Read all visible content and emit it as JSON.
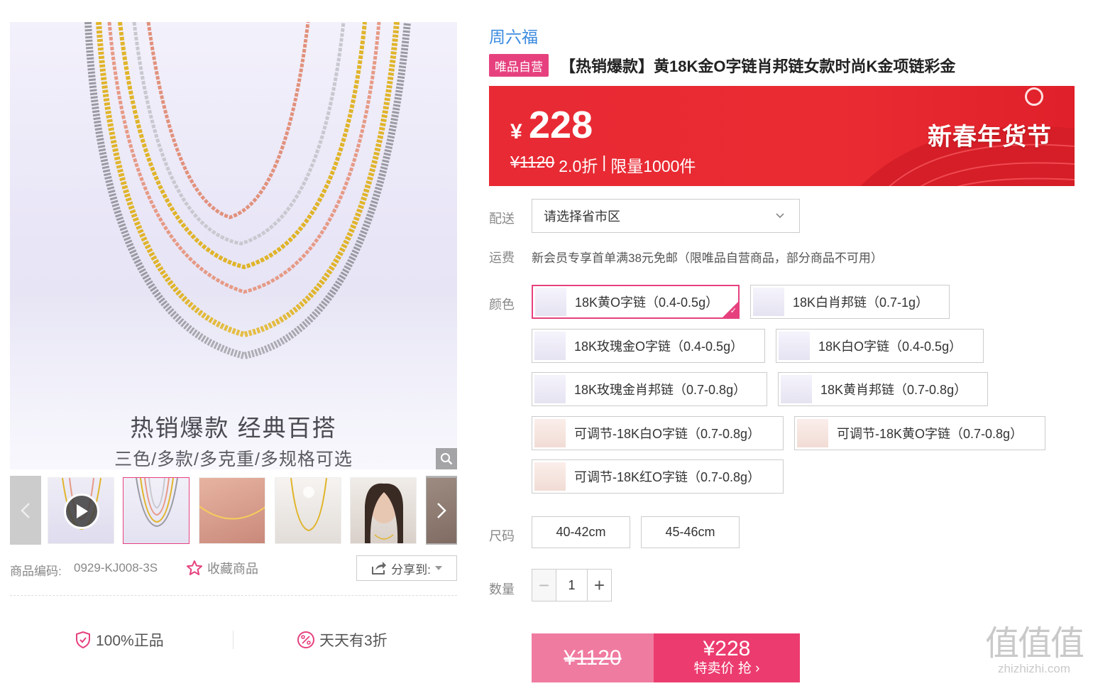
{
  "gallery": {
    "slogan_main": "热销爆款 经典百搭",
    "slogan_sub": "三色/多款/多克重/多规格可选",
    "sku_label": "商品编码:",
    "sku_value": "0929-KJ008-3S",
    "favorite_label": "收藏商品",
    "share_label": "分享到:",
    "assurances": [
      "100%正品",
      "天天有3折"
    ]
  },
  "product": {
    "brand": "周六福",
    "self_badge": "唯品自营",
    "title": "【热销爆款】黄18K金O字链肖邦链女款时尚K金项链彩金"
  },
  "price": {
    "currency": "¥",
    "current": "228",
    "original": "¥1120",
    "discount": "2.0折",
    "separator": "|",
    "limit": "限量1000件",
    "festival": "新春年货节"
  },
  "delivery": {
    "label": "配送",
    "placeholder": "请选择省市区"
  },
  "shipping": {
    "label": "运费",
    "text": "新会员专享首单满38元免邮（限唯品自营商品，部分商品不可用）"
  },
  "color": {
    "label": "颜色",
    "options": [
      "18K黄O字链（0.4-0.5g）",
      "18K白肖邦链（0.7-1g）",
      "18K玫瑰金O字链（0.4-0.5g）",
      "18K白O字链（0.4-0.5g）",
      "18K玫瑰金肖邦链（0.7-0.8g）",
      "18K黄肖邦链（0.7-0.8g）",
      "可调节-18K白O字链（0.7-0.8g）",
      "可调节-18K黄O字链（0.7-0.8g）",
      "可调节-18K红O字链（0.7-0.8g）"
    ],
    "selected_index": 0
  },
  "size": {
    "label": "尺码",
    "options": [
      "40-42cm",
      "45-46cm"
    ]
  },
  "quantity": {
    "label": "数量",
    "value": "1",
    "minus": "−",
    "plus": "+"
  },
  "buy": {
    "original": "¥1120",
    "price": "¥228",
    "cta": "特卖价 抢 ›"
  },
  "watermark": {
    "big": "值值值",
    "small": "zhizhizhi.com"
  },
  "colors": {
    "accent": "#e6417e",
    "banner_red": "#e82a34",
    "brand_blue": "#3b8be0",
    "buy_light": "#f07ba0",
    "buy_dark": "#ec3c6f"
  }
}
